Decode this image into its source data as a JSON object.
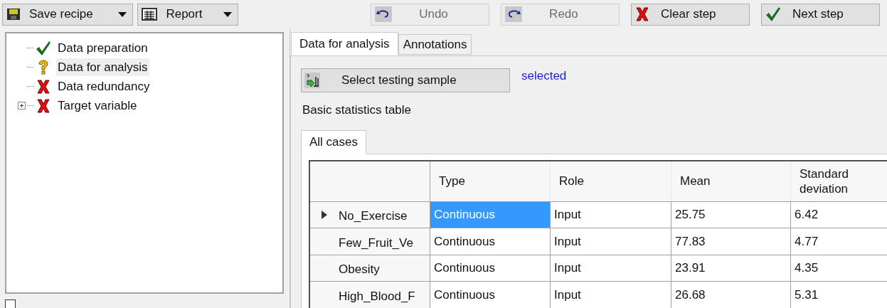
{
  "toolbar": [
    {
      "kind": "save",
      "label": "Save recipe",
      "dropdown": true,
      "disabled": false
    },
    {
      "kind": "report",
      "label": "Report",
      "dropdown": true,
      "disabled": false
    },
    {
      "kind": "undo",
      "label": "Undo",
      "dropdown": false,
      "disabled": true
    },
    {
      "kind": "redo",
      "label": "Redo",
      "dropdown": false,
      "disabled": true
    },
    {
      "kind": "clear",
      "label": "Clear step",
      "dropdown": false,
      "disabled": false
    },
    {
      "kind": "next",
      "label": "Next step",
      "dropdown": false,
      "disabled": false
    }
  ],
  "tree": [
    {
      "label": "Data preparation",
      "kind": "done",
      "expandable": false,
      "selected": false
    },
    {
      "label": "Data for analysis",
      "kind": "pending",
      "expandable": false,
      "selected": true
    },
    {
      "label": "Data redundancy",
      "kind": "failed",
      "expandable": false,
      "selected": false
    },
    {
      "label": "Target variable",
      "kind": "failed",
      "expandable": true,
      "selected": false
    }
  ],
  "bottom_checkbox": {
    "checked": false
  },
  "tabs": [
    {
      "label": "Data for analysis",
      "selected": true
    },
    {
      "label": "Annotations",
      "selected": false
    }
  ],
  "sample_button": {
    "label": "Select testing sample"
  },
  "sample_status": "selected",
  "section_title": "Basic statistics table",
  "inner_tabs": [
    {
      "label": "All cases",
      "selected": true
    }
  ],
  "table": {
    "columns": [
      "Type",
      "Role",
      "Mean",
      "Standard deviation"
    ],
    "rows": [
      {
        "name": "No_Exercise",
        "current": true,
        "cells": [
          {
            "text": "Continuous",
            "selected": true
          },
          {
            "text": "Input",
            "selected": false
          },
          {
            "text": "25.75",
            "selected": false
          },
          {
            "text": "6.42",
            "selected": false
          }
        ]
      },
      {
        "name": "Few_Fruit_Ve",
        "current": false,
        "cells": [
          {
            "text": "Continuous",
            "selected": false
          },
          {
            "text": "Input",
            "selected": false
          },
          {
            "text": "77.83",
            "selected": false
          },
          {
            "text": "4.77",
            "selected": false
          }
        ]
      },
      {
        "name": "Obesity",
        "current": false,
        "cells": [
          {
            "text": "Continuous",
            "selected": false
          },
          {
            "text": "Input",
            "selected": false
          },
          {
            "text": "23.91",
            "selected": false
          },
          {
            "text": "4.35",
            "selected": false
          }
        ]
      },
      {
        "name": "High_Blood_F",
        "current": false,
        "cells": [
          {
            "text": "Continuous",
            "selected": false
          },
          {
            "text": "Input",
            "selected": false
          },
          {
            "text": "26.68",
            "selected": false
          },
          {
            "text": "5.31",
            "selected": false
          }
        ]
      }
    ]
  }
}
